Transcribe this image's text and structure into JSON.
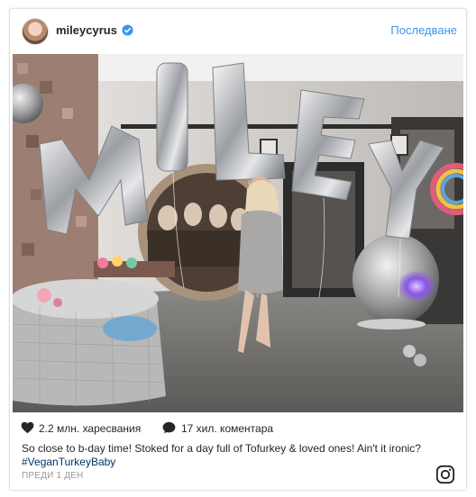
{
  "post": {
    "username": "mileycyrus",
    "follow_label": "Последване",
    "likes_text": "2.2 млн. харесвания",
    "comments_text": "17 хил. коментара",
    "caption_text": "So close to b-day time! Stoked for a day full of Tofurkey & loved ones! Ain't it ironic? ",
    "caption_hashtag": "#VeganTurkeyBaby",
    "timestamp": "ПРЕДИ 1 ДЕН"
  },
  "icons": {
    "verified": "verified-badge-icon",
    "like": "heart-icon",
    "comment": "comment-bubble-icon",
    "brand": "instagram-logo-icon"
  },
  "colors": {
    "link_blue": "#3897f0",
    "hashtag_blue": "#003569",
    "text": "#262626",
    "muted": "#999999"
  }
}
